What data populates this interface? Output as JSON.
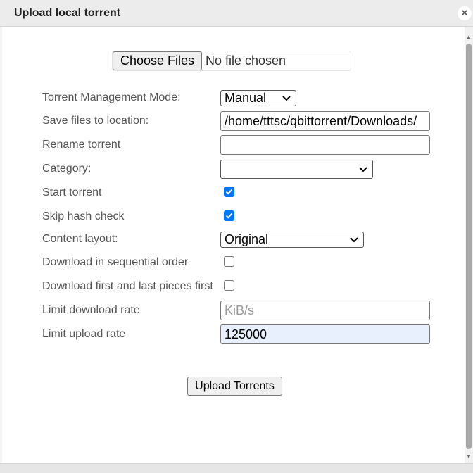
{
  "window": {
    "title": "Upload local torrent",
    "close_glyph": "×",
    "icons": {
      "close": "close-icon",
      "dropdown": "chevron-down-icon",
      "check": "check-icon"
    }
  },
  "file_picker": {
    "button_label": "Choose Files",
    "status": "No file chosen"
  },
  "form": {
    "management_mode": {
      "label": "Torrent Management Mode:",
      "value": "Manual"
    },
    "save_location": {
      "label": "Save files to location:",
      "value": "/home/tttsc/qbittorrent/Downloads/"
    },
    "rename": {
      "label": "Rename torrent",
      "value": ""
    },
    "category": {
      "label": "Category:",
      "value": ""
    },
    "start_torrent": {
      "label": "Start torrent",
      "checked": true
    },
    "skip_hash_check": {
      "label": "Skip hash check",
      "checked": true
    },
    "content_layout": {
      "label": "Content layout:",
      "value": "Original"
    },
    "sequential": {
      "label": "Download in sequential order",
      "checked": false
    },
    "first_last_pieces": {
      "label": "Download first and last pieces first",
      "checked": false
    },
    "limit_download": {
      "label": "Limit download rate",
      "value": "",
      "placeholder": "KiB/s"
    },
    "limit_upload": {
      "label": "Limit upload rate",
      "value": "125000"
    }
  },
  "actions": {
    "upload_label": "Upload Torrents"
  },
  "colors": {
    "checkbox_accent": "#0075ff",
    "autofill_bg": "#e8f0fe"
  }
}
